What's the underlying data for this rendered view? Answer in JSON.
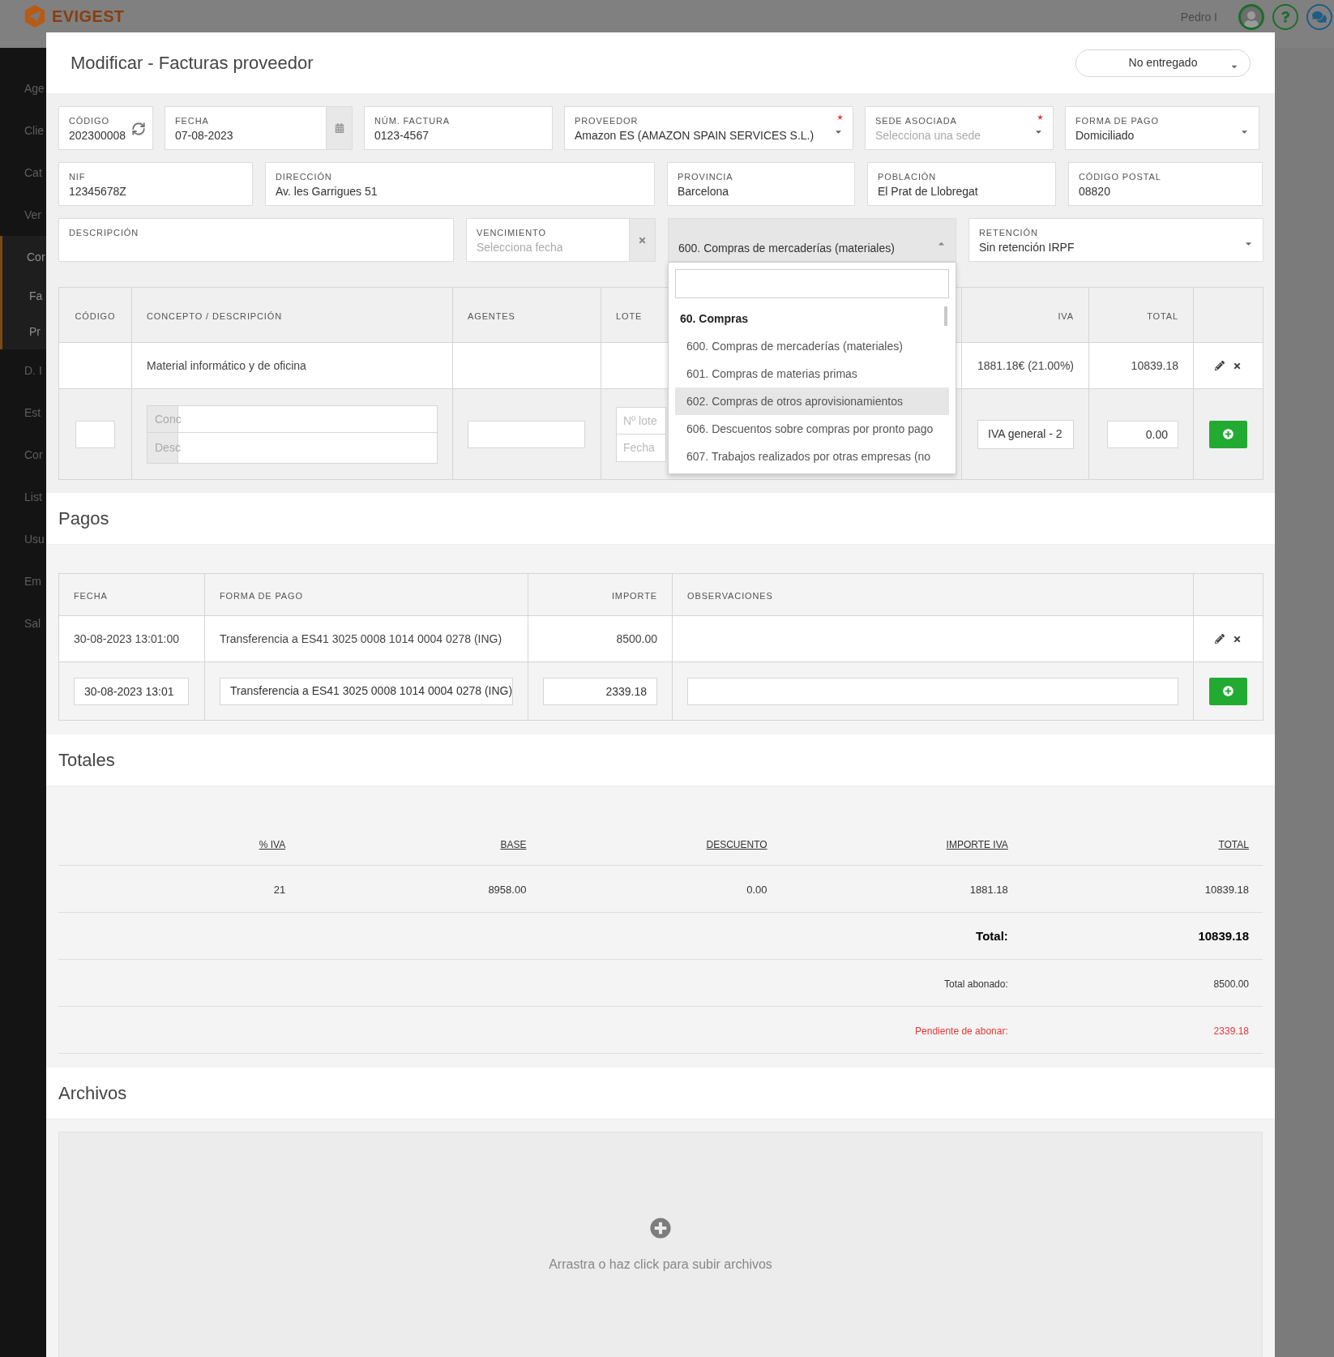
{
  "app": {
    "logo": "EVIGEST",
    "user": "Pedro I",
    "menu": [
      {
        "label": "Age",
        "kind": "item",
        "active": false
      },
      {
        "label": "Clie",
        "kind": "item",
        "active": false
      },
      {
        "label": "Cat",
        "kind": "item",
        "active": false
      },
      {
        "label": "Ver",
        "kind": "item",
        "active": false
      },
      {
        "label": "Cor",
        "kind": "item",
        "active": true
      },
      {
        "label": "Fa",
        "kind": "sub",
        "active": true
      },
      {
        "label": "Pr",
        "kind": "sub",
        "active": true
      },
      {
        "label": "D. I",
        "kind": "item",
        "active": false
      },
      {
        "label": "Est",
        "kind": "item",
        "active": false
      },
      {
        "label": "Cor",
        "kind": "item",
        "active": false
      },
      {
        "label": "List",
        "kind": "item",
        "active": false
      },
      {
        "label": "Usu",
        "kind": "item",
        "active": false
      },
      {
        "label": "Em",
        "kind": "item",
        "active": false
      },
      {
        "label": "Sal",
        "kind": "item",
        "active": false
      }
    ]
  },
  "modal": {
    "title": "Modificar - Facturas proveedor",
    "status": "No entregado"
  },
  "form": {
    "rows": [
      {
        "fields": [
          {
            "kind": "code",
            "label": "CÓDIGO",
            "value": "202300008",
            "required": false
          },
          {
            "kind": "date",
            "label": "FECHA",
            "value": "07-08-2023",
            "required": false
          },
          {
            "kind": "text",
            "label": "NÚM. FACTURA",
            "value": "0123-4567",
            "required": false
          },
          {
            "kind": "select",
            "label": "PROVEEDOR",
            "value": "Amazon ES (AMAZON SPAIN SERVICES S.L.)",
            "required": true,
            "open": false
          },
          {
            "kind": "select",
            "label": "SEDE ASOCIADA",
            "placeholder": "Selecciona una sede",
            "required": true,
            "open": false
          },
          {
            "kind": "select",
            "label": "FORMA DE PAGO",
            "value": "Domiciliado",
            "required": false,
            "open": false
          }
        ]
      },
      {
        "fields": [
          {
            "kind": "text",
            "label": "NIF",
            "value": "12345678Z",
            "required": false
          },
          {
            "kind": "text",
            "label": "DIRECCIÓN",
            "value": "Av. les Garrigues 51",
            "required": false
          },
          {
            "kind": "text",
            "label": "PROVINCIA",
            "value": "Barcelona",
            "required": false
          },
          {
            "kind": "text",
            "label": "POBLACIÓN",
            "value": "El Prat de Llobregat",
            "required": false
          },
          {
            "kind": "text",
            "label": "CÓDIGO POSTAL",
            "value": "08820",
            "required": false
          }
        ]
      },
      {
        "fields": [
          {
            "kind": "text",
            "label": "DESCRIPCIÓN",
            "required": false
          },
          {
            "kind": "date-clear",
            "label": "VENCIMIENTO",
            "placeholder": "Selecciona fecha",
            "required": false
          },
          {
            "kind": "select",
            "value": "600. Compras de mercaderías (materiales)",
            "required": false,
            "open": true,
            "dropdown": {
              "groups": [
                {
                  "label": "60. Compras",
                  "options": [
                    {
                      "label": "600. Compras de mercaderías (materiales)",
                      "highlighted": false
                    },
                    {
                      "label": "601. Compras de materias primas",
                      "highlighted": false
                    },
                    {
                      "label": "602. Compras de otros aprovisionamientos",
                      "highlighted": true
                    },
                    {
                      "label": "606. Descuentos sobre compras por pronto pago",
                      "highlighted": false
                    },
                    {
                      "label": "607. Trabajos realizados por otras empresas (no",
                      "highlighted": false
                    }
                  ]
                }
              ]
            }
          },
          {
            "kind": "select",
            "label": "RETENCIÓN",
            "value": "Sin retención IRPF",
            "required": false,
            "open": false
          }
        ]
      }
    ]
  },
  "lines": {
    "columns": [
      "CÓDIGO",
      "CONCEPTO / DESCRIPCIÓN",
      "AGENTES",
      "LOTE",
      "IVA",
      "TOTAL"
    ],
    "rows": [
      {
        "concept": "Material informático y de oficina",
        "iva": "1881.18€ (21.00%)",
        "total": "10839.18"
      }
    ],
    "new_line": {
      "concept_addon": "Conc",
      "description_addon": "Desc",
      "lot_placeholder": "Nº lote",
      "date_placeholder": "Fecha",
      "iva": "IVA general - 2",
      "total": "0.00"
    }
  },
  "payments": {
    "title": "Pagos",
    "columns": [
      "FECHA",
      "FORMA DE PAGO",
      "IMPORTE",
      "OBSERVACIONES"
    ],
    "rows": [
      {
        "date": "30-08-2023 13:01:00",
        "method": "Transferencia a ES41 3025 0008 1014 0004 0278 (ING)",
        "amount": "8500.00"
      }
    ],
    "new_payment": {
      "date": "30-08-2023 13:01",
      "method": "Transferencia a ES41 3025 0008 1014 0004 0278 (ING)",
      "amount": "2339.18"
    }
  },
  "totals": {
    "title": "Totales",
    "columns": [
      "% IVA",
      "BASE",
      "DESCUENTO",
      "IMPORTE IVA",
      "TOTAL"
    ],
    "rows": [
      {
        "cells": [
          "21",
          "8958.00",
          "0.00",
          "1881.18",
          "10839.18"
        ]
      }
    ],
    "summary": [
      {
        "kind": "grand",
        "label": "Total:",
        "value": "10839.18"
      },
      {
        "kind": "paid",
        "label": "Total abonado:",
        "value": "8500.00"
      },
      {
        "kind": "pending",
        "label": "Pendiente de abonar:",
        "value": "2339.18"
      }
    ]
  },
  "files": {
    "title": "Archivos",
    "hint": "Arrastra o haz click para subir archivos"
  }
}
